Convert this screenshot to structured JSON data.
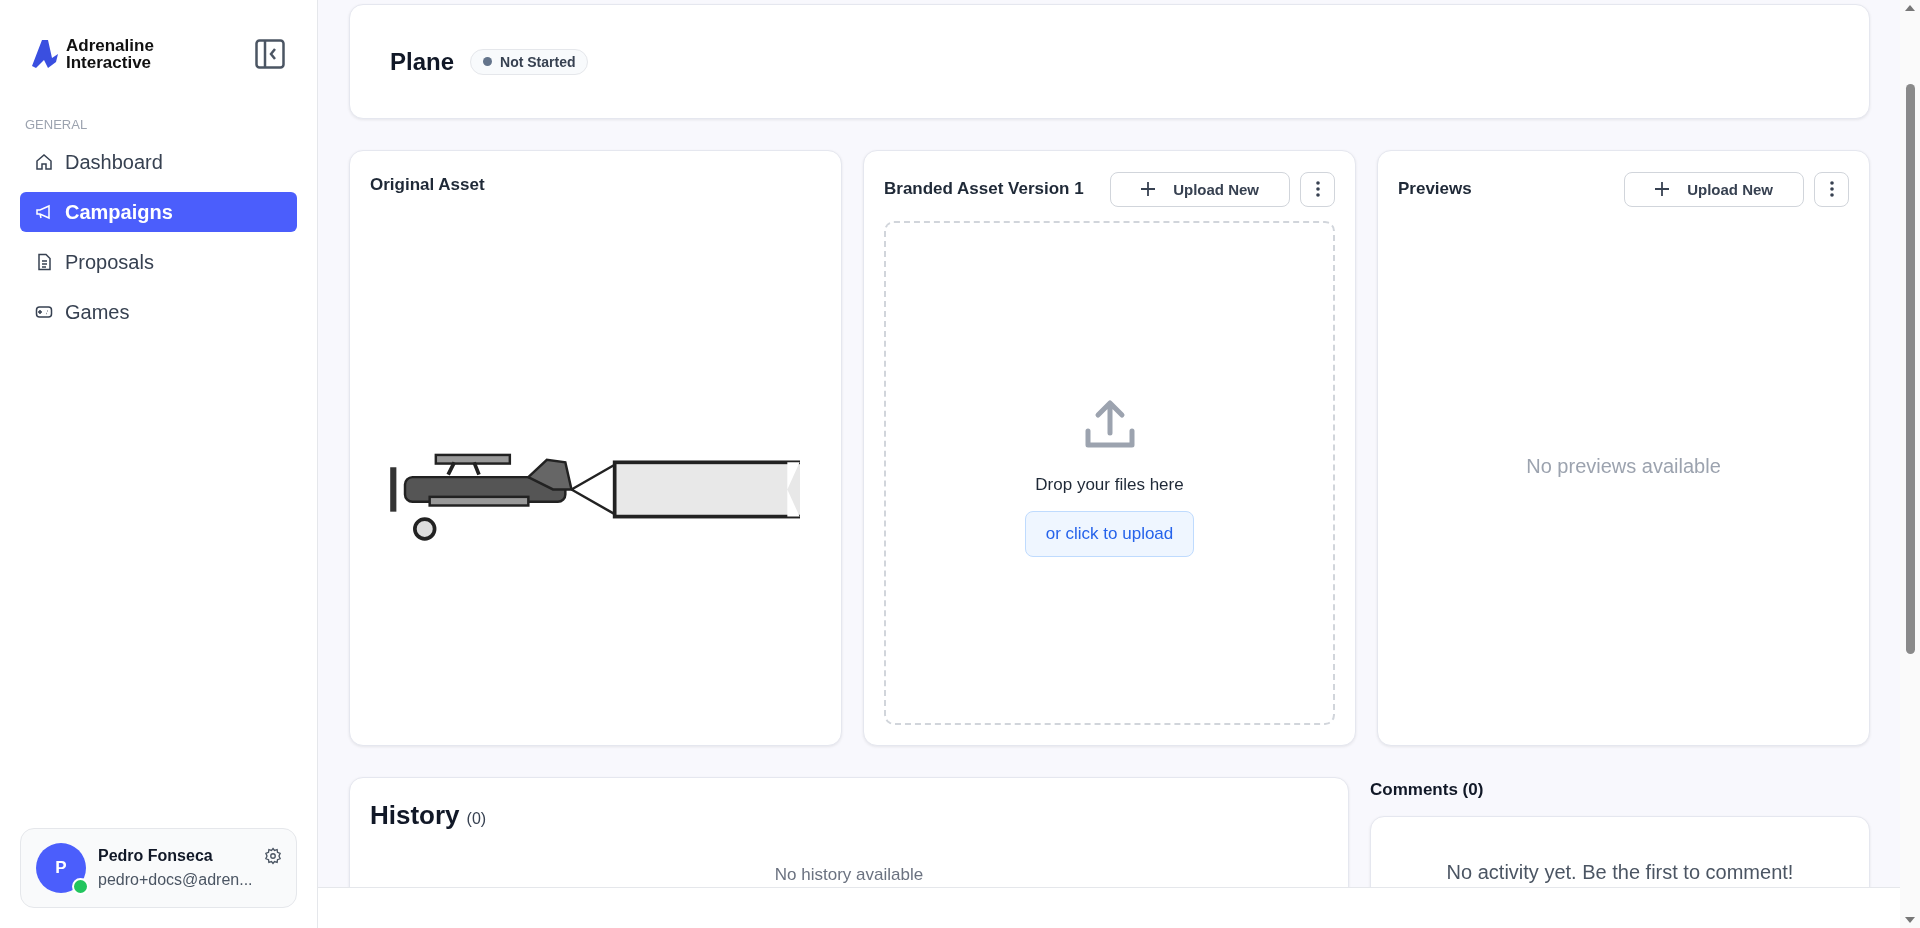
{
  "sidebar": {
    "brand": [
      "Adrenaline",
      "Interactive"
    ],
    "section_label": "GENERAL",
    "items": [
      {
        "label": "Dashboard",
        "selected": false
      },
      {
        "label": "Campaigns",
        "selected": true
      },
      {
        "label": "Proposals",
        "selected": false
      },
      {
        "label": "Games",
        "selected": false
      }
    ],
    "user": {
      "initial": "P",
      "name": "Pedro Fonseca",
      "email": "pedro+docs@adren...",
      "online": true
    }
  },
  "header": {
    "title": "Plane",
    "status": "Not Started"
  },
  "original_asset": {
    "title": "Original Asset",
    "kind": "picture"
  },
  "branded_asset": {
    "title": "Branded Asset Version 1",
    "upload_button": "Upload New",
    "drop_text": "Drop your files here",
    "drop_button": "or click to upload"
  },
  "previews": {
    "title": "Previews",
    "upload_button": "Upload New",
    "empty": "No previews available"
  },
  "history": {
    "title": "History",
    "count": "(0)",
    "empty": "No history available"
  },
  "comments": {
    "title": "Comments (0)",
    "empty": "No activity yet. Be the first to comment!"
  }
}
